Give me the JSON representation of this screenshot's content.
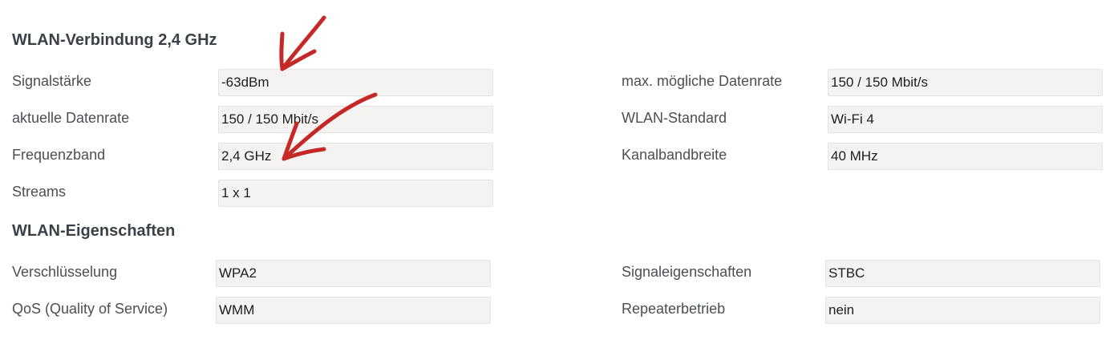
{
  "section_connection": {
    "title": "WLAN-Verbindung 2,4 GHz",
    "rows": {
      "signal_strength": {
        "label": "Signalstärke",
        "value": "-63dBm"
      },
      "current_rate": {
        "label": "aktuelle Datenrate",
        "value": "150 / 150 Mbit/s"
      },
      "frequency_band": {
        "label": "Frequenzband",
        "value": "2,4 GHz"
      },
      "streams": {
        "label": "Streams",
        "value": "1 x 1"
      },
      "max_rate": {
        "label": "max. mögliche Datenrate",
        "value": "150 / 150 Mbit/s"
      },
      "wlan_standard": {
        "label": "WLAN-Standard",
        "value": "Wi-Fi 4"
      },
      "channel_bandwidth": {
        "label": "Kanalbandbreite",
        "value": "40 MHz"
      }
    }
  },
  "section_properties": {
    "title": "WLAN-Eigenschaften",
    "rows": {
      "encryption": {
        "label": "Verschlüsselung",
        "value": "WPA2"
      },
      "qos": {
        "label": "QoS (Quality of Service)",
        "value": "WMM"
      },
      "signal_properties": {
        "label": "Signaleigenschaften",
        "value": "STBC"
      },
      "repeater_mode": {
        "label": "Repeaterbetrieb",
        "value": "nein"
      }
    }
  },
  "annotation_color": "#c62828"
}
